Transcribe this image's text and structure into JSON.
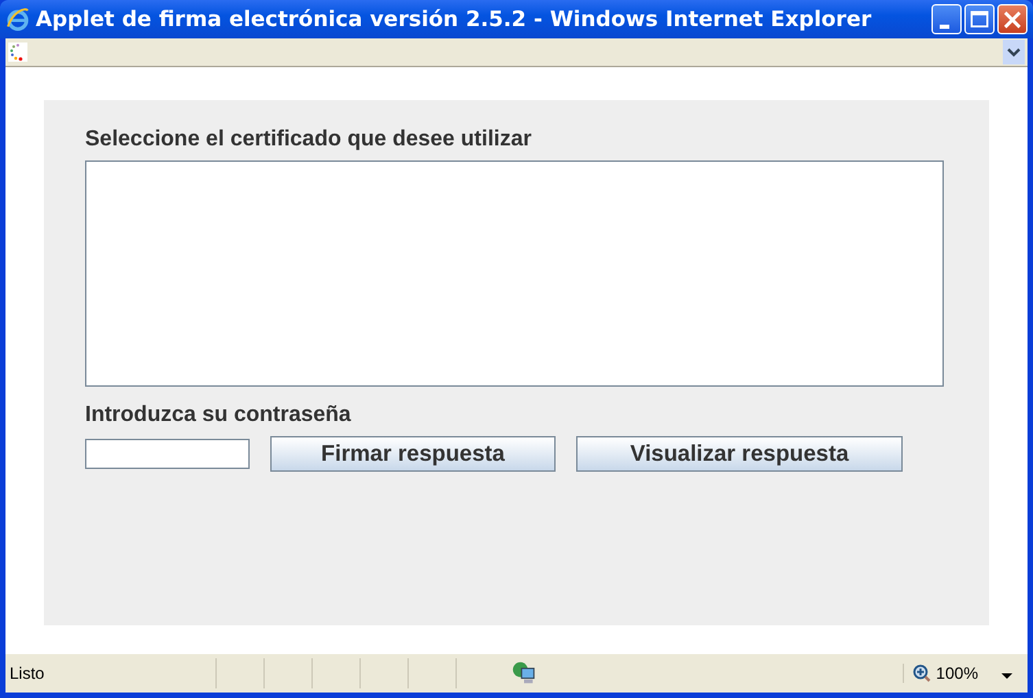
{
  "window": {
    "title": "Applet de firma electrónica versión 2.5.2 - Windows Internet Explorer"
  },
  "applet": {
    "certificate_label": "Seleccione el certificado que desee utilizar",
    "password_label": "Introduzca su contraseña",
    "buttons": [
      "Firmar respuesta",
      "Visualizar respuesta"
    ]
  },
  "status_bar": {
    "text": "Listo",
    "zoom": "100%"
  }
}
